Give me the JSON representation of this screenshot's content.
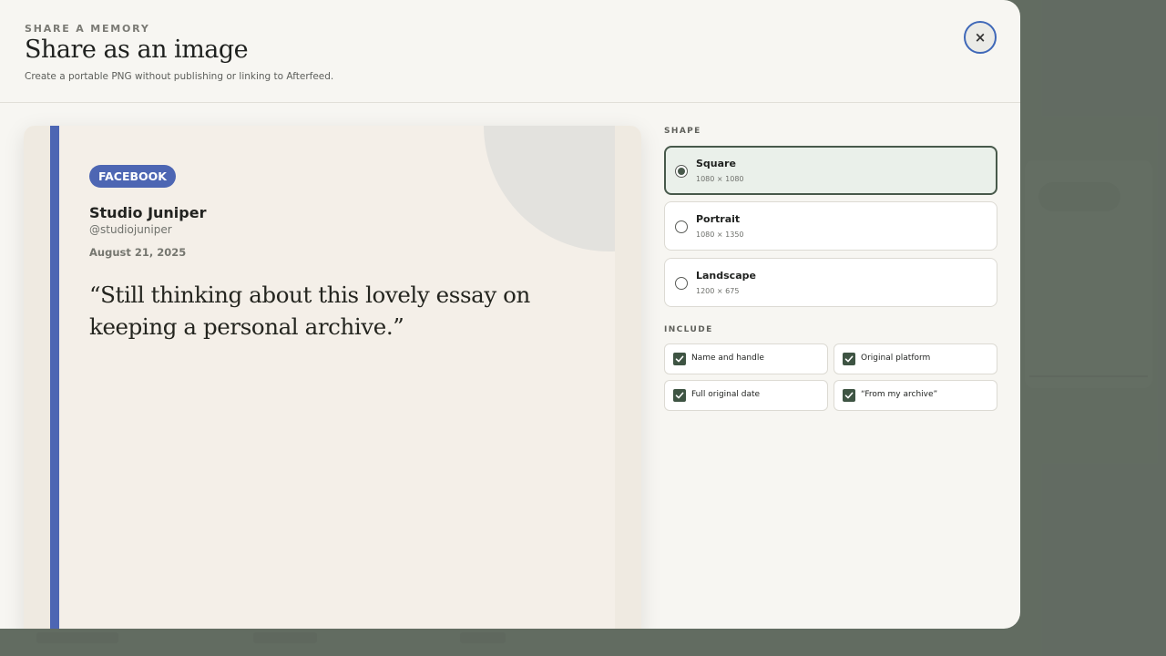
{
  "header": {
    "eyebrow": "SHARE A MEMORY",
    "title": "Share as an image",
    "subtitle": "Create a portable PNG without publishing or linking to Afterfeed.",
    "close_label": "×"
  },
  "preview": {
    "platform": "FACEBOOK",
    "author_name": "Studio Juniper",
    "author_handle": "@studiojuniper",
    "date": "August 21, 2025",
    "quote": "“Still thinking about this lovely essay on keeping a personal archive.”"
  },
  "shape": {
    "label": "SHAPE",
    "options": [
      {
        "label": "Square",
        "size": "1080 × 1080",
        "selected": true
      },
      {
        "label": "Portrait",
        "size": "1080 × 1350",
        "selected": false
      },
      {
        "label": "Landscape",
        "size": "1200 × 675",
        "selected": false
      }
    ]
  },
  "include": {
    "label": "INCLUDE",
    "options": [
      {
        "label": "Name and handle",
        "checked": true
      },
      {
        "label": "Original platform",
        "checked": true
      },
      {
        "label": "Full original date",
        "checked": true
      },
      {
        "label": "“From my archive”",
        "checked": true
      }
    ]
  },
  "colors": {
    "accent_platform": "#4d66b3",
    "selected_green": "#48594b",
    "checkbox_green": "#3e5443",
    "close_ring": "#3f68b8"
  }
}
